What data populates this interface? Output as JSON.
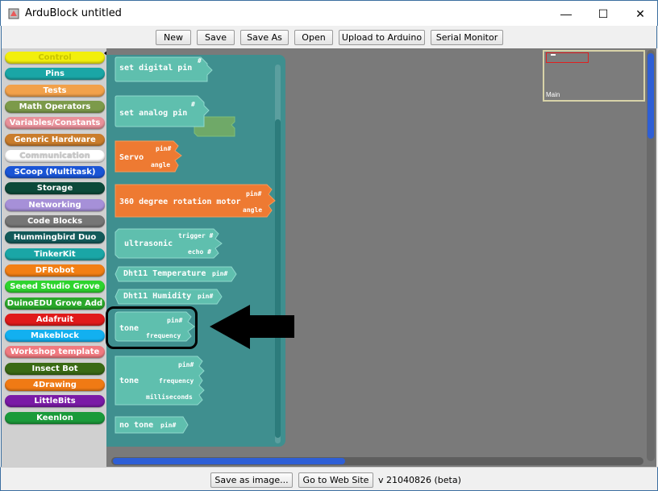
{
  "window": {
    "title": "ArduBlock untitled",
    "min_glyph": "—",
    "max_glyph": "☐",
    "close_glyph": "✕"
  },
  "toolbar": {
    "new_label": "New",
    "save_label": "Save",
    "save_as_label": "Save As",
    "open_label": "Open",
    "upload_label": "Upload to Arduino",
    "serial_label": "Serial Monitor"
  },
  "categories": [
    {
      "label": "Control",
      "color": "#f2ef0c",
      "text": "#c8c400"
    },
    {
      "label": "Pins",
      "color": "#1aa6a6",
      "text": "#ffffff"
    },
    {
      "label": "Tests",
      "color": "#f2a14a",
      "text": "#ffffff"
    },
    {
      "label": "Math Operators",
      "color": "#7c9a4a",
      "text": "#ffffff"
    },
    {
      "label": "Variables/Constants",
      "color": "#e8919a",
      "text": "#ffffff"
    },
    {
      "label": "Generic Hardware",
      "color": "#ca7d2c",
      "text": "#ffffff"
    },
    {
      "label": "Communication",
      "color": "#ffffff",
      "text": "#d8d8d8"
    },
    {
      "label": "SCoop (Multitask)",
      "color": "#1a55d6",
      "text": "#ffffff"
    },
    {
      "label": "Storage",
      "color": "#0c4a3a",
      "text": "#ffffff"
    },
    {
      "label": "Networking",
      "color": "#a690d8",
      "text": "#ffffff"
    },
    {
      "label": "Code Blocks",
      "color": "#767676",
      "text": "#ffffff"
    },
    {
      "label": "Hummingbird Duo",
      "color": "#135a5a",
      "text": "#ffffff"
    },
    {
      "label": "TinkerKit",
      "color": "#1aa6a6",
      "text": "#ffffff"
    },
    {
      "label": "DFRobot",
      "color": "#f27f14",
      "text": "#ffffff"
    },
    {
      "label": "Seeed Studio Grove",
      "color": "#2ed42e",
      "text": "#ffffff"
    },
    {
      "label": "DuinoEDU Grove Add",
      "color": "#2aa82a",
      "text": "#ffffff"
    },
    {
      "label": "Adafruit",
      "color": "#e01a1a",
      "text": "#ffffff"
    },
    {
      "label": "Makeblock",
      "color": "#12b0f0",
      "text": "#ffffff"
    },
    {
      "label": "Workshop template",
      "color": "#f07a80",
      "text": "#ffffff"
    },
    {
      "label": "Insect Bot",
      "color": "#3a6a14",
      "text": "#ffffff"
    },
    {
      "label": "4Drawing",
      "color": "#f07a14",
      "text": "#ffffff"
    },
    {
      "label": "LittleBits",
      "color": "#7a1aa6",
      "text": "#ffffff"
    },
    {
      "label": "Keenlon",
      "color": "#1a9a3a",
      "text": "#ffffff"
    }
  ],
  "blocks": {
    "set_digital": {
      "label": "set digital pin",
      "sock": "#"
    },
    "set_analog": {
      "label": "set analog pin",
      "sock": "#"
    },
    "servo": {
      "label": "Servo",
      "sock1": "pin#",
      "sock2": "angle"
    },
    "rotation": {
      "label": "360 degree rotation motor",
      "sock1": "pin#",
      "sock2": "angle"
    },
    "ultrasonic": {
      "label": "ultrasonic",
      "sock1": "trigger #",
      "sock2": "echo #"
    },
    "dht_temp": {
      "label": "Dht11 Temperature",
      "sock": "pin#"
    },
    "dht_hum": {
      "label": "Dht11 Humidity",
      "sock": "pin#"
    },
    "tone1": {
      "label": "tone",
      "sock1": "pin#",
      "sock2": "frequency"
    },
    "tone2": {
      "label": "tone",
      "sock1": "pin#",
      "sock2": "frequency",
      "sock3": "milliseconds"
    },
    "no_tone": {
      "label": "no tone",
      "sock": "pin#"
    }
  },
  "minimap": {
    "label": "Main"
  },
  "bottom": {
    "save_image_label": "Save as image...",
    "website_label": "Go to Web Site",
    "version": "v 21040826 (beta)"
  },
  "colors": {
    "pin_block": "#5fbfae",
    "orange_block": "#ee7a32",
    "drawer": "#3f8f8f",
    "accent_scroll": "#2e5fd6"
  }
}
